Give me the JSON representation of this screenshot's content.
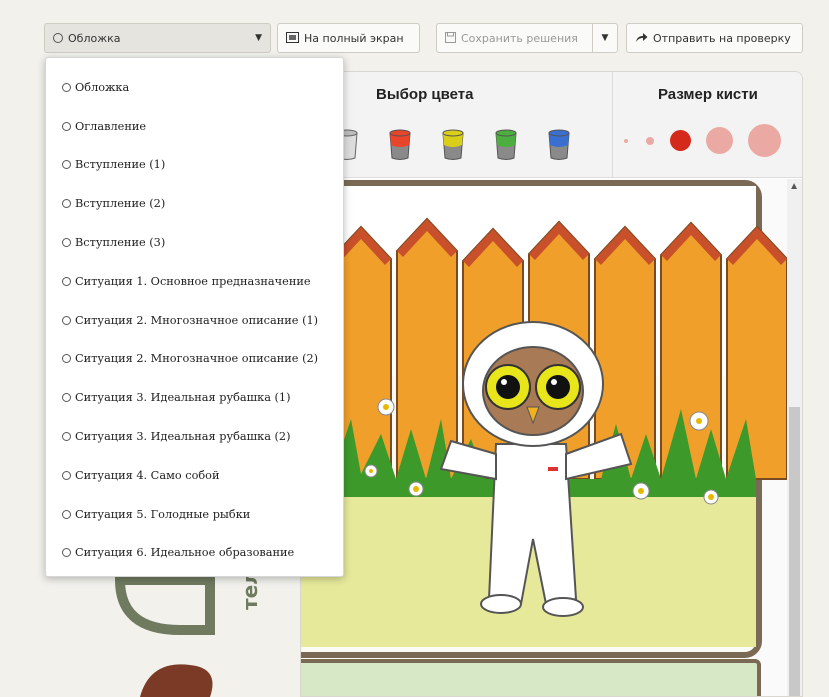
{
  "toolbar": {
    "page_select_value": "Обложка",
    "fullscreen_label": "На полный экран",
    "save_label": "Сохранить решения",
    "submit_label": "Отправить на проверку"
  },
  "pages_dropdown": [
    "Обложка",
    "Оглавление",
    "Вступление (1)",
    "Вступление (2)",
    "Вступление (3)",
    "Ситуация 1. Основное предназначение",
    "Ситуация 2. Многозначное описание (1)",
    "Ситуация 2. Многозначное описание (2)",
    "Ситуация 3. Идеальная рубашка (1)",
    "Ситуация 3. Идеальная рубашка (2)",
    "Ситуация 4. Само собой",
    "Ситуация 5. Голодные рыбки",
    "Ситуация 6. Идеальное образование"
  ],
  "tools": {
    "color_title": "Выбор цвета",
    "brush_title": "Размер кисти",
    "colors": [
      "#e0e0e0",
      "#e8452a",
      "#d9cf1a",
      "#4cae3e",
      "#3a6fd1"
    ],
    "brush_sizes_color_active": "#d32a1b",
    "brush_sizes_color": "#eba9a3"
  },
  "canvas": {
    "fence_color": "#f0a02a",
    "fence_top_color": "#c8502a",
    "grass_color": "#3d9a2a",
    "ground_color": "#e6e99a",
    "frame_color": "#7a6a55",
    "side_text": "тельны"
  }
}
